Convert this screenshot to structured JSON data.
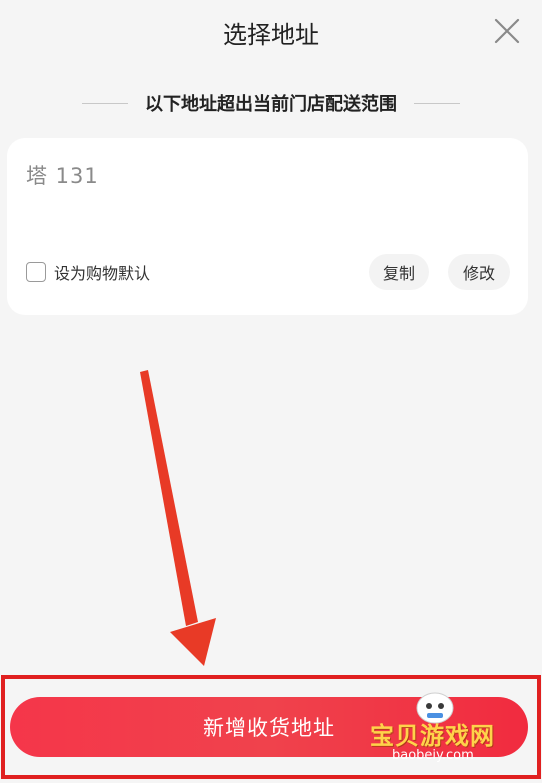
{
  "header": {
    "title": "选择地址",
    "close_icon": "close-icon"
  },
  "notice": {
    "text": "以下地址超出当前门店配送范围"
  },
  "address_card": {
    "address": "塔  131",
    "default_label": "设为购物默认",
    "copy_label": "复制",
    "edit_label": "修改"
  },
  "bottom": {
    "add_button_label": "新增收货地址"
  },
  "watermark": {
    "text": "宝贝游戏网",
    "domain": "baobeiy.com"
  },
  "colors": {
    "accent": "#f0424c",
    "annotation_red": "#e02020",
    "background": "#f5f5f5"
  }
}
